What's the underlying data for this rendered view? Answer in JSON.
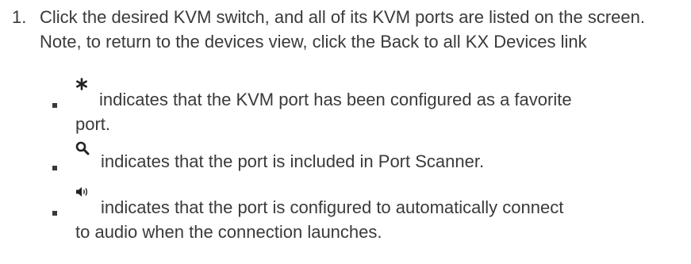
{
  "step": {
    "number": "1.",
    "text": "Click the desired KVM switch, and all of its KVM ports are listed on the screen. Note, to return to the devices view, click the Back to all KX Devices link"
  },
  "bullets": [
    {
      "icon": "asterisk-favorite-icon",
      "line1": "indicates that the KVM port has been configured as a favorite",
      "line2": "port."
    },
    {
      "icon": "magnifier-scan-icon",
      "line1": "indicates that the port is included in Port Scanner.",
      "line2": ""
    },
    {
      "icon": "speaker-audio-icon",
      "line1": "indicates that the port is configured to automatically connect",
      "line2": "to audio when the connection launches."
    }
  ],
  "colors": {
    "text": "#3a3a3a",
    "background": "#ffffff"
  }
}
